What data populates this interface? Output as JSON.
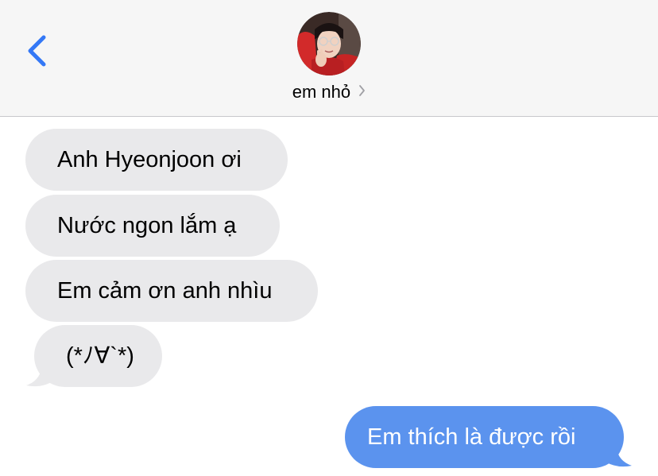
{
  "header": {
    "contact_name": "em nhỏ",
    "back_icon": "chevron-left-icon",
    "name_chevron_icon": "chevron-right-icon",
    "accent_color": "#3478f6"
  },
  "messages": [
    {
      "direction": "incoming",
      "text": "Anh Hyeonjoon ơi"
    },
    {
      "direction": "incoming",
      "text": "Nước ngon lắm ạ"
    },
    {
      "direction": "incoming",
      "text": "Em cảm ơn anh nhìu"
    },
    {
      "direction": "incoming",
      "text": "(*ﾉ∀`*)"
    },
    {
      "direction": "outgoing",
      "text": "Em thích là được rồi"
    }
  ],
  "colors": {
    "incoming_bubble": "#e9e9eb",
    "outgoing_bubble": "#5b93ee",
    "header_bg": "#f6f6f6"
  }
}
